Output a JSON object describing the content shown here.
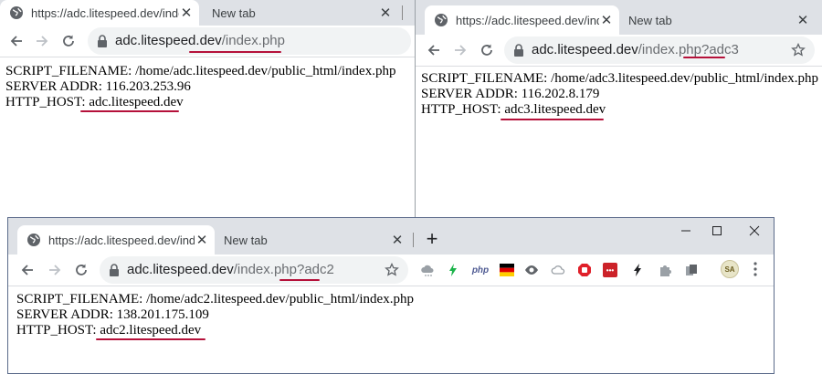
{
  "windows": {
    "top_left": {
      "tabs": [
        {
          "title": "https://adc.litespeed.dev/inde"
        },
        {
          "title": "New tab"
        }
      ],
      "address": {
        "host": "adc.litespeed.dev",
        "path": "/index.php"
      },
      "content": {
        "line1": "SCRIPT_FILENAME: /home/adc.litespeed.dev/public_html/index.php",
        "line2": "SERVER ADDR: 116.203.253.96",
        "line3_label": "HTTP_HOST: ",
        "line3_value": "adc.litespeed.dev"
      }
    },
    "top_right": {
      "tabs": [
        {
          "title": "https://adc.litespeed.dev/inde"
        },
        {
          "title": "New tab"
        }
      ],
      "address": {
        "host": "adc.litespeed.dev",
        "path": "/index.php?adc3"
      },
      "content": {
        "line1": "SCRIPT_FILENAME: /home/adc3.litespeed.dev/public_html/index.php",
        "line2": "SERVER ADDR: 116.202.8.179",
        "line3_label": "HTTP_HOST: ",
        "line3_value": "adc3.litespeed.dev"
      }
    },
    "bottom": {
      "tabs": [
        {
          "title": "https://adc.litespeed.dev/inde"
        },
        {
          "title": "New tab"
        }
      ],
      "new_tab_symbol": "+",
      "address": {
        "host": "adc.litespeed.dev",
        "path": "/index.php?adc2"
      },
      "extensions": [
        "cloud-extension-icon",
        "bolt-extension-icon",
        "php-extension-icon",
        "german-flag-extension-icon",
        "eye-extension-icon",
        "cloud-sync-extension-icon",
        "adblock-extension-icon",
        "lastpass-extension-icon",
        "lightning-extension-icon",
        "puzzle-extension-icon",
        "copy-extension-icon"
      ],
      "lastpass_text": "•••",
      "php_text": "php",
      "avatar_initials": "SA",
      "content": {
        "line1": "SCRIPT_FILENAME: /home/adc2.litespeed.dev/public_html/index.php",
        "line2": "SERVER ADDR: 138.201.175.109",
        "line3_label": "HTTP_HOST: ",
        "line3_value": "adc2.litespeed.dev"
      }
    }
  },
  "colors": {
    "annotation": "#b5113a",
    "tabstrip": "#dee1e6",
    "omnibox": "#f1f3f4"
  }
}
